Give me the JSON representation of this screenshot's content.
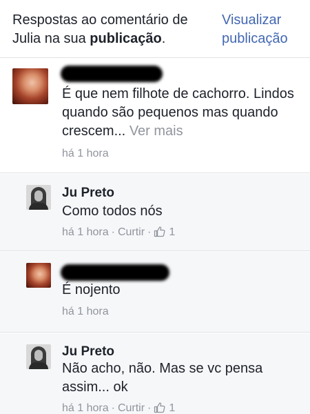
{
  "header": {
    "title_prefix": "Respostas ao comentário de Julia na sua ",
    "title_bold": "publicação",
    "title_suffix": ".",
    "view_link": "Visualizar publicação"
  },
  "comments": [
    {
      "author": "",
      "text": "É que nem filhote de cachorro. Lindos quando são pequenos mas quando crescem...",
      "see_more": "Ver mais",
      "time": "há 1 hora"
    },
    {
      "author": "Ju Preto",
      "text": "Como todos nós",
      "time": "há 1 hora",
      "like_action": "Curtir",
      "likes": "1"
    },
    {
      "author": "",
      "text": "É nojento",
      "time": "há 1 hora"
    },
    {
      "author": "Ju Preto",
      "text": "Não acho, não. Mas se vc pensa assim... ok",
      "time": "há 1 hora",
      "like_action": "Curtir",
      "likes": "1"
    }
  ],
  "separator": "·",
  "colors": {
    "link": "#4267b2",
    "meta": "#90949c",
    "reply_bg": "#f6f7f9"
  }
}
